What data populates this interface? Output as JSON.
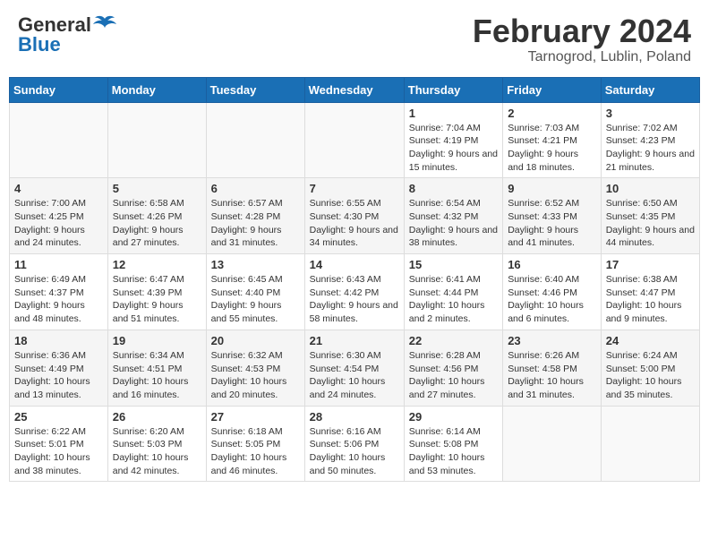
{
  "header": {
    "logo_general": "General",
    "logo_blue": "Blue",
    "month_title": "February 2024",
    "location": "Tarnogrod, Lublin, Poland"
  },
  "days_of_week": [
    "Sunday",
    "Monday",
    "Tuesday",
    "Wednesday",
    "Thursday",
    "Friday",
    "Saturday"
  ],
  "weeks": [
    [
      {
        "num": "",
        "info": ""
      },
      {
        "num": "",
        "info": ""
      },
      {
        "num": "",
        "info": ""
      },
      {
        "num": "",
        "info": ""
      },
      {
        "num": "1",
        "info": "Sunrise: 7:04 AM\nSunset: 4:19 PM\nDaylight: 9 hours\nand 15 minutes."
      },
      {
        "num": "2",
        "info": "Sunrise: 7:03 AM\nSunset: 4:21 PM\nDaylight: 9 hours\nand 18 minutes."
      },
      {
        "num": "3",
        "info": "Sunrise: 7:02 AM\nSunset: 4:23 PM\nDaylight: 9 hours\nand 21 minutes."
      }
    ],
    [
      {
        "num": "4",
        "info": "Sunrise: 7:00 AM\nSunset: 4:25 PM\nDaylight: 9 hours\nand 24 minutes."
      },
      {
        "num": "5",
        "info": "Sunrise: 6:58 AM\nSunset: 4:26 PM\nDaylight: 9 hours\nand 27 minutes."
      },
      {
        "num": "6",
        "info": "Sunrise: 6:57 AM\nSunset: 4:28 PM\nDaylight: 9 hours\nand 31 minutes."
      },
      {
        "num": "7",
        "info": "Sunrise: 6:55 AM\nSunset: 4:30 PM\nDaylight: 9 hours\nand 34 minutes."
      },
      {
        "num": "8",
        "info": "Sunrise: 6:54 AM\nSunset: 4:32 PM\nDaylight: 9 hours\nand 38 minutes."
      },
      {
        "num": "9",
        "info": "Sunrise: 6:52 AM\nSunset: 4:33 PM\nDaylight: 9 hours\nand 41 minutes."
      },
      {
        "num": "10",
        "info": "Sunrise: 6:50 AM\nSunset: 4:35 PM\nDaylight: 9 hours\nand 44 minutes."
      }
    ],
    [
      {
        "num": "11",
        "info": "Sunrise: 6:49 AM\nSunset: 4:37 PM\nDaylight: 9 hours\nand 48 minutes."
      },
      {
        "num": "12",
        "info": "Sunrise: 6:47 AM\nSunset: 4:39 PM\nDaylight: 9 hours\nand 51 minutes."
      },
      {
        "num": "13",
        "info": "Sunrise: 6:45 AM\nSunset: 4:40 PM\nDaylight: 9 hours\nand 55 minutes."
      },
      {
        "num": "14",
        "info": "Sunrise: 6:43 AM\nSunset: 4:42 PM\nDaylight: 9 hours\nand 58 minutes."
      },
      {
        "num": "15",
        "info": "Sunrise: 6:41 AM\nSunset: 4:44 PM\nDaylight: 10 hours\nand 2 minutes."
      },
      {
        "num": "16",
        "info": "Sunrise: 6:40 AM\nSunset: 4:46 PM\nDaylight: 10 hours\nand 6 minutes."
      },
      {
        "num": "17",
        "info": "Sunrise: 6:38 AM\nSunset: 4:47 PM\nDaylight: 10 hours\nand 9 minutes."
      }
    ],
    [
      {
        "num": "18",
        "info": "Sunrise: 6:36 AM\nSunset: 4:49 PM\nDaylight: 10 hours\nand 13 minutes."
      },
      {
        "num": "19",
        "info": "Sunrise: 6:34 AM\nSunset: 4:51 PM\nDaylight: 10 hours\nand 16 minutes."
      },
      {
        "num": "20",
        "info": "Sunrise: 6:32 AM\nSunset: 4:53 PM\nDaylight: 10 hours\nand 20 minutes."
      },
      {
        "num": "21",
        "info": "Sunrise: 6:30 AM\nSunset: 4:54 PM\nDaylight: 10 hours\nand 24 minutes."
      },
      {
        "num": "22",
        "info": "Sunrise: 6:28 AM\nSunset: 4:56 PM\nDaylight: 10 hours\nand 27 minutes."
      },
      {
        "num": "23",
        "info": "Sunrise: 6:26 AM\nSunset: 4:58 PM\nDaylight: 10 hours\nand 31 minutes."
      },
      {
        "num": "24",
        "info": "Sunrise: 6:24 AM\nSunset: 5:00 PM\nDaylight: 10 hours\nand 35 minutes."
      }
    ],
    [
      {
        "num": "25",
        "info": "Sunrise: 6:22 AM\nSunset: 5:01 PM\nDaylight: 10 hours\nand 38 minutes."
      },
      {
        "num": "26",
        "info": "Sunrise: 6:20 AM\nSunset: 5:03 PM\nDaylight: 10 hours\nand 42 minutes."
      },
      {
        "num": "27",
        "info": "Sunrise: 6:18 AM\nSunset: 5:05 PM\nDaylight: 10 hours\nand 46 minutes."
      },
      {
        "num": "28",
        "info": "Sunrise: 6:16 AM\nSunset: 5:06 PM\nDaylight: 10 hours\nand 50 minutes."
      },
      {
        "num": "29",
        "info": "Sunrise: 6:14 AM\nSunset: 5:08 PM\nDaylight: 10 hours\nand 53 minutes."
      },
      {
        "num": "",
        "info": ""
      },
      {
        "num": "",
        "info": ""
      }
    ]
  ]
}
